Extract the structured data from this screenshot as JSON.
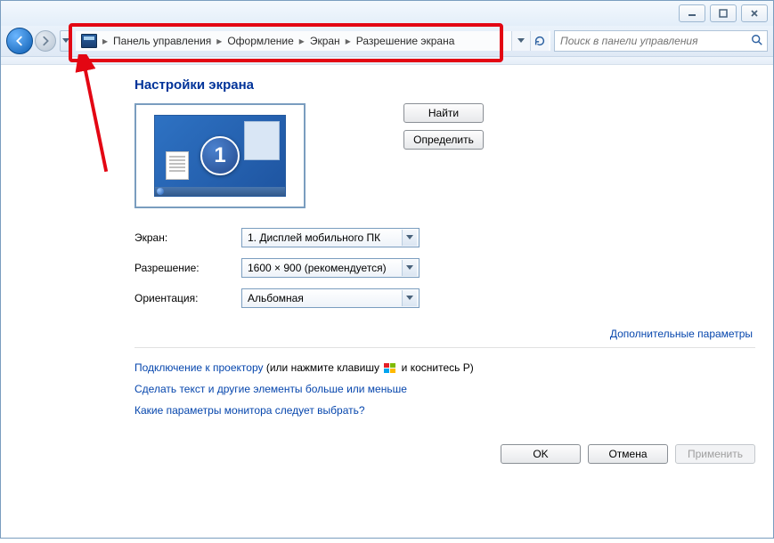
{
  "breadcrumb": {
    "items": [
      "Панель управления",
      "Оформление",
      "Экран",
      "Разрешение экрана"
    ]
  },
  "search": {
    "placeholder": "Поиск в панели управления"
  },
  "page": {
    "title": "Настройки экрана"
  },
  "monitor": {
    "number": "1"
  },
  "side_buttons": {
    "detect": "Найти",
    "identify": "Определить"
  },
  "form": {
    "display_label": "Экран:",
    "display_value": "1. Дисплей мобильного ПК",
    "resolution_label": "Разрешение:",
    "resolution_value": "1600 × 900 (рекомендуется)",
    "orientation_label": "Ориентация:",
    "orientation_value": "Альбомная"
  },
  "links": {
    "advanced": "Дополнительные параметры",
    "projector_a": "Подключение к проектору",
    "projector_b": " (или нажмите клавишу ",
    "projector_c": " и коснитесь P)",
    "text_size": "Сделать текст и другие элементы больше или меньше",
    "which_monitor": "Какие параметры монитора следует выбрать?"
  },
  "buttons": {
    "ok": "OK",
    "cancel": "Отмена",
    "apply": "Применить"
  }
}
